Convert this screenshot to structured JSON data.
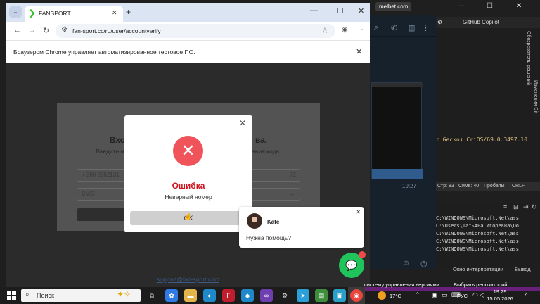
{
  "browser": {
    "tab_title": "FANSPORT",
    "tab_favicon": "fansport-logo-icon",
    "url": "fan-sport.cc/ru/user/accountverify",
    "infobar_text": "Браузером Chrome управляет автоматизированное тестовое ПО."
  },
  "page": {
    "card_title": "Вход ... ва.",
    "card_title_left": "Вхо",
    "card_title_right": "ва.",
    "card_sub_left": "Введите недоста",
    "card_sub_right": "об получения кода.",
    "phone_value": "+ 380 9382131",
    "phone_code": "72",
    "method_value": "SMS",
    "support_email": "support@fan-sport.com"
  },
  "modal": {
    "title": "Ошибка",
    "message": "Неверный номер",
    "ok_label": "OK"
  },
  "chat": {
    "agent_name": "Kate",
    "message": "Нужна помощь?"
  },
  "bg": {
    "tab": "melbet.com",
    "copilot": "GitHub Copilot",
    "code_line": "r Gecko) CriOS/69.0.3497.10",
    "tg_time": "19:27",
    "status": {
      "row": "Стр: 83",
      "col": "Симв: 40",
      "spaces": "Пробелы",
      "eol": "CRLF"
    },
    "output_lines": [
      "C:\\WINDOWS\\Microsoft.Net\\ass",
      "C:\\Users\\Татьяна Игоревна\\Do",
      "C:\\WINDOWS\\Microsoft.Net\\ass",
      "C:\\WINDOWS\\Microsoft.Net\\ass",
      "C:\\WINDOWS\\Microsoft.Net\\ass"
    ],
    "out_tab_immediate": "Окно интерпретации",
    "out_tab_output": "Вывод",
    "side_git": "Изменения Git",
    "side_solution": "Обозреватель решений"
  },
  "taskbar": {
    "search": "Поиск",
    "vs_status_left": "систему управления версиями",
    "vs_status_right": "Выбрать репозиторий",
    "temperature": "17°C",
    "lang": "РУС",
    "time": "19:29",
    "date": "15.05.2026",
    "notif_count": "4"
  },
  "colors": {
    "error_red": "#d0141c",
    "error_icon": "#f0545a",
    "chat_green": "#1fc45a",
    "vs_purple": "#68217a"
  }
}
